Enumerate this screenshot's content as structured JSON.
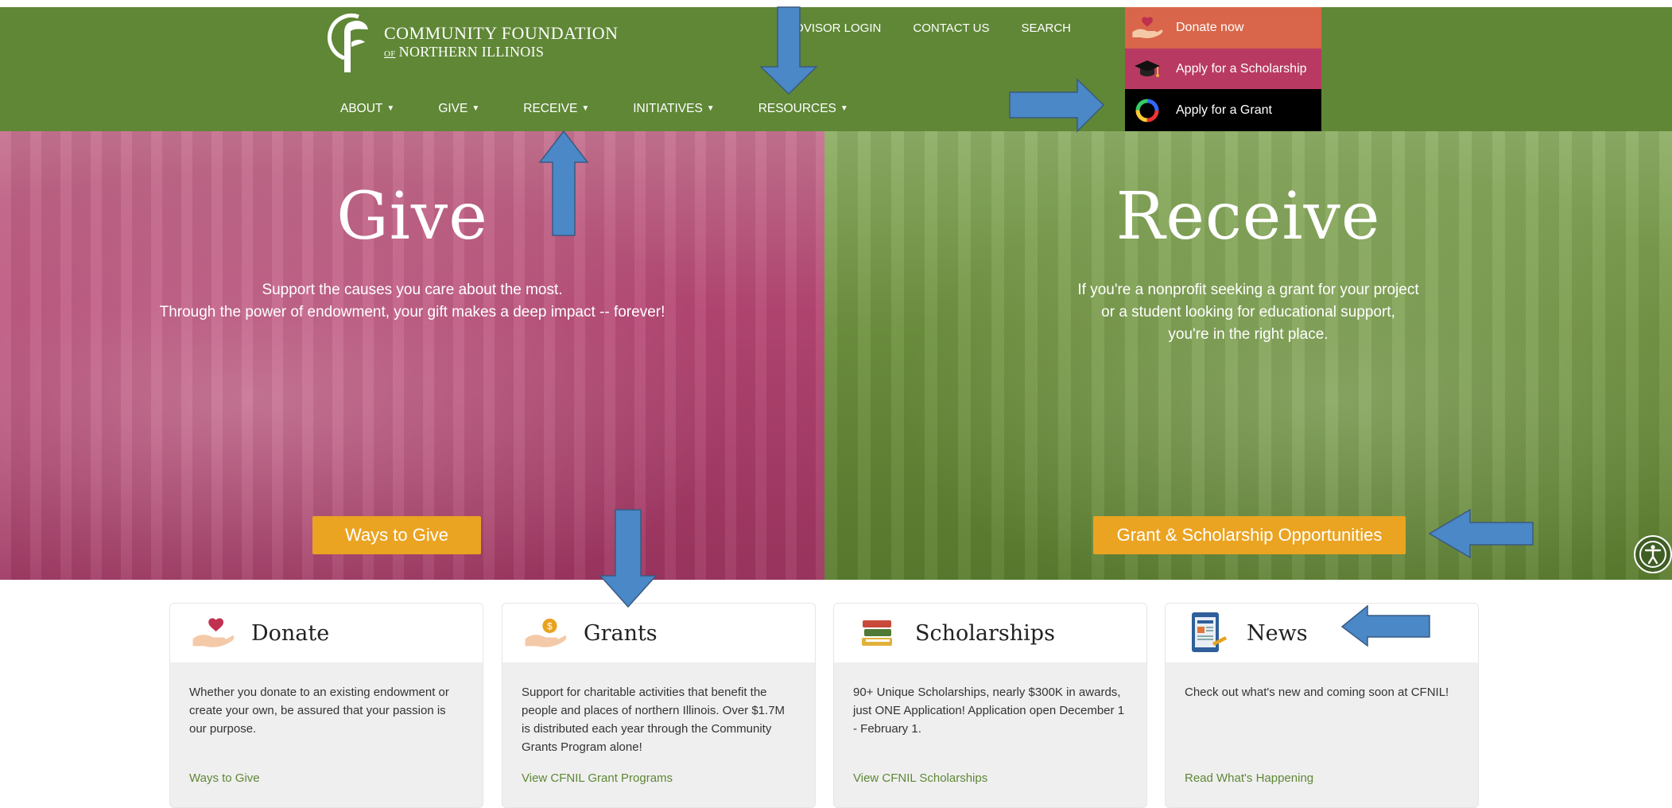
{
  "header": {
    "logo": {
      "line1": "COMMUNITY FOUNDATION",
      "line2_prefix": "OF",
      "line2": "NORTHERN ILLINOIS"
    },
    "utility_links": [
      "DVISOR LOGIN",
      "CONTACT US",
      "SEARCH"
    ],
    "nav": [
      "ABOUT",
      "GIVE",
      "RECEIVE",
      "INITIATIVES",
      "RESOURCES"
    ],
    "cta": [
      {
        "label": "Donate now",
        "icon": "heart-hand-icon"
      },
      {
        "label": "Apply for a Scholarship",
        "icon": "graduation-cap-icon"
      },
      {
        "label": "Apply for a Grant",
        "icon": "color-ring-icon"
      }
    ]
  },
  "hero": {
    "give": {
      "title": "Give",
      "line1": "Support the causes you care about the most.",
      "line2": "Through the power of endowment, your gift makes a deep impact -- forever!",
      "button": "Ways to Give"
    },
    "receive": {
      "title": "Receive",
      "line1": "If you're a nonprofit seeking a grant for your project",
      "line2": "or a student looking for educational support,",
      "line3": "you're in the right place.",
      "button": "Grant & Scholarship Opportunities"
    }
  },
  "cards": [
    {
      "title": "Donate",
      "icon": "heart-hand-icon",
      "text": "Whether you donate to an existing endowment or create your own, be assured that your passion is our purpose.",
      "link": "Ways to Give"
    },
    {
      "title": "Grants",
      "icon": "coin-hand-icon",
      "text": "Support for charitable activities that benefit the people and places of northern Illinois. Over $1.7M is distributed each year through the Community Grants Program alone!",
      "link": "View CFNIL Grant Programs"
    },
    {
      "title": "Scholarships",
      "icon": "books-icon",
      "text": "90+ Unique Scholarships, nearly $300K in awards, just ONE Application! Application open December 1 - February 1.",
      "link": "View CFNIL Scholarships"
    },
    {
      "title": "News",
      "icon": "newspaper-icon",
      "text": "Check out what's new and coming soon at CFNIL!",
      "link": "Read What's Happening"
    }
  ],
  "colors": {
    "header_green": "#5f8736",
    "give_overlay": "#b54673",
    "receive_overlay": "#6f923f",
    "button_orange": "#eaa422",
    "annotation_arrow": "#4a88c7"
  }
}
